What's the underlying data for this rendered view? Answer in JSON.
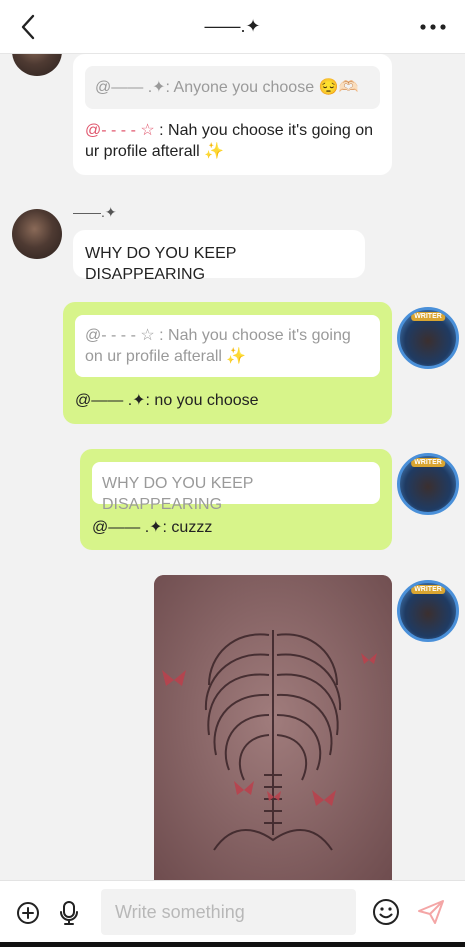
{
  "header": {
    "title": "——.✦",
    "back_icon": "chevron-left-icon",
    "more_icon": "more-dots-icon"
  },
  "messages": {
    "m1": {
      "quote_text": "@—— .✦: Anyone you choose 😔🫶🏻",
      "mention": "@- - - - ☆",
      "text": " : Nah you choose it's going on ur profile afterall ✨"
    },
    "m2": {
      "sender": "——.✦",
      "text": "WHY DO YOU KEEP DISAPPEARING"
    },
    "m3": {
      "quote_text": "@- - - - ☆ : Nah you choose it's going on ur profile afterall ✨",
      "text": "@—— .✦: no you choose"
    },
    "m4": {
      "quote_text": "WHY DO YOU KEEP DISAPPEARING",
      "text": "@—— .✦: cuzzz"
    },
    "avatar_badge": "WRITER"
  },
  "input": {
    "placeholder": "Write something",
    "value": "",
    "add_icon": "plus-circle-icon",
    "mic_icon": "microphone-icon",
    "emoji_icon": "emoji-smile-icon",
    "send_icon": "send-icon"
  },
  "colors": {
    "self_bubble": "#d7f48a",
    "other_bubble": "#ffffff",
    "mention": "#e0566d",
    "send": "#f4a6a6"
  }
}
